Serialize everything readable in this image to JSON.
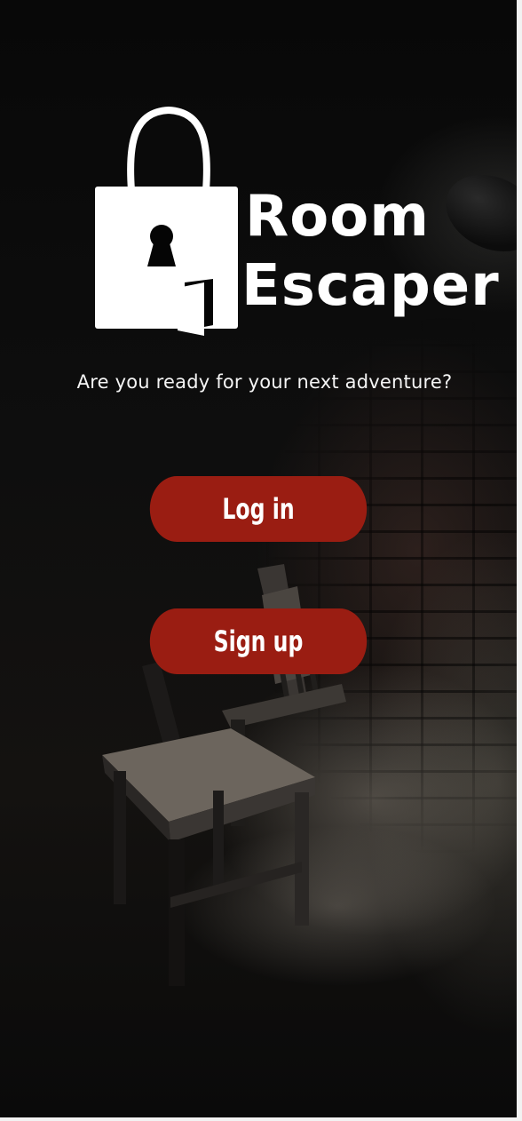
{
  "logo": {
    "line1": "Room",
    "line2": "Escaper"
  },
  "tagline": "Are you ready for your next adventure?",
  "buttons": {
    "login_label": "Log in",
    "signup_label": "Sign up"
  },
  "colors": {
    "button_background": "#9a1d12",
    "button_text": "#ffffff",
    "logo": "#ffffff",
    "background": "#0a0a0a"
  },
  "icons": {
    "logo_icon": "padlock-bag-with-door-icon"
  }
}
